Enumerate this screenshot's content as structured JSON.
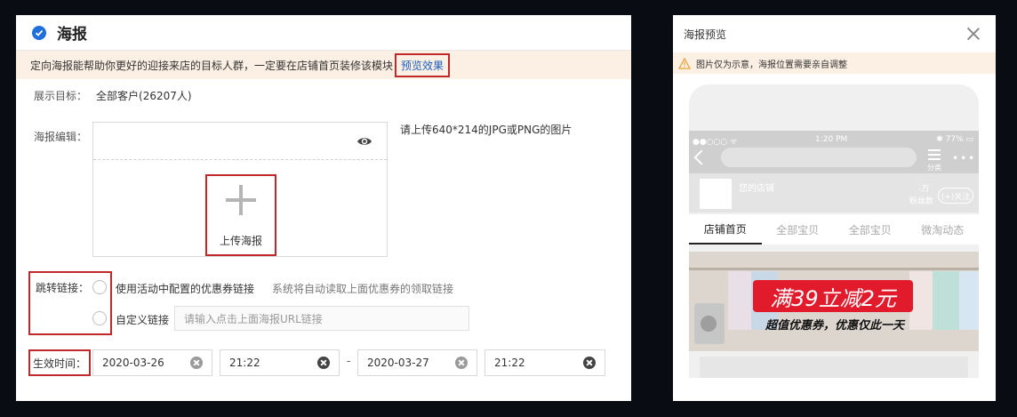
{
  "editor": {
    "title": "海报",
    "notice_text": "定向海报能帮助你更好的迎接来店的目标人群，一定要在店铺首页装修该模块",
    "preview_link": "预览效果",
    "target_label": "展示目标：",
    "target_value": "全部客户(26207人)",
    "poster_label": "海报编辑：",
    "upload_label": "上传海报",
    "upload_hint": "请上传640*214的JPG或PNG的图片",
    "jump_label": "跳转链接：",
    "option1_label": "使用活动中配置的优惠券链接",
    "option1_desc": "系统将自动读取上面优惠券的领取链接",
    "option2_label": "自定义链接",
    "url_placeholder": "请输入点击上面海报URL链接",
    "time_label": "生效时间：",
    "start_date": "2020-03-26",
    "start_time": "21:22",
    "separator": "-",
    "end_date": "2020-03-27",
    "end_time": "21:22"
  },
  "preview": {
    "title": "海报预览",
    "notice": "图片仅为示意，海报位置需要亲自调整",
    "status_left": "●●○○○ ᯤ",
    "status_time": "1:20 PM",
    "status_right": "✱ 77% ▭",
    "category_label": "分类",
    "more": "•••",
    "shop_name": "您的店铺",
    "fans_count": "-万",
    "fans_label": "粉丝数",
    "follow_label": "(+)关注",
    "tabs": [
      "店铺首页",
      "全部宝贝",
      "全部宝贝",
      "微淘动态"
    ],
    "banner_headline": "满39立减2元",
    "banner_sub": "超值优惠券，优惠仅此一天"
  },
  "colors": {
    "accent_blue": "#1e6fd9",
    "highlight_red": "#c0282a",
    "notice_bg": "#fcefe3",
    "sale_red": "#e21b2c"
  }
}
